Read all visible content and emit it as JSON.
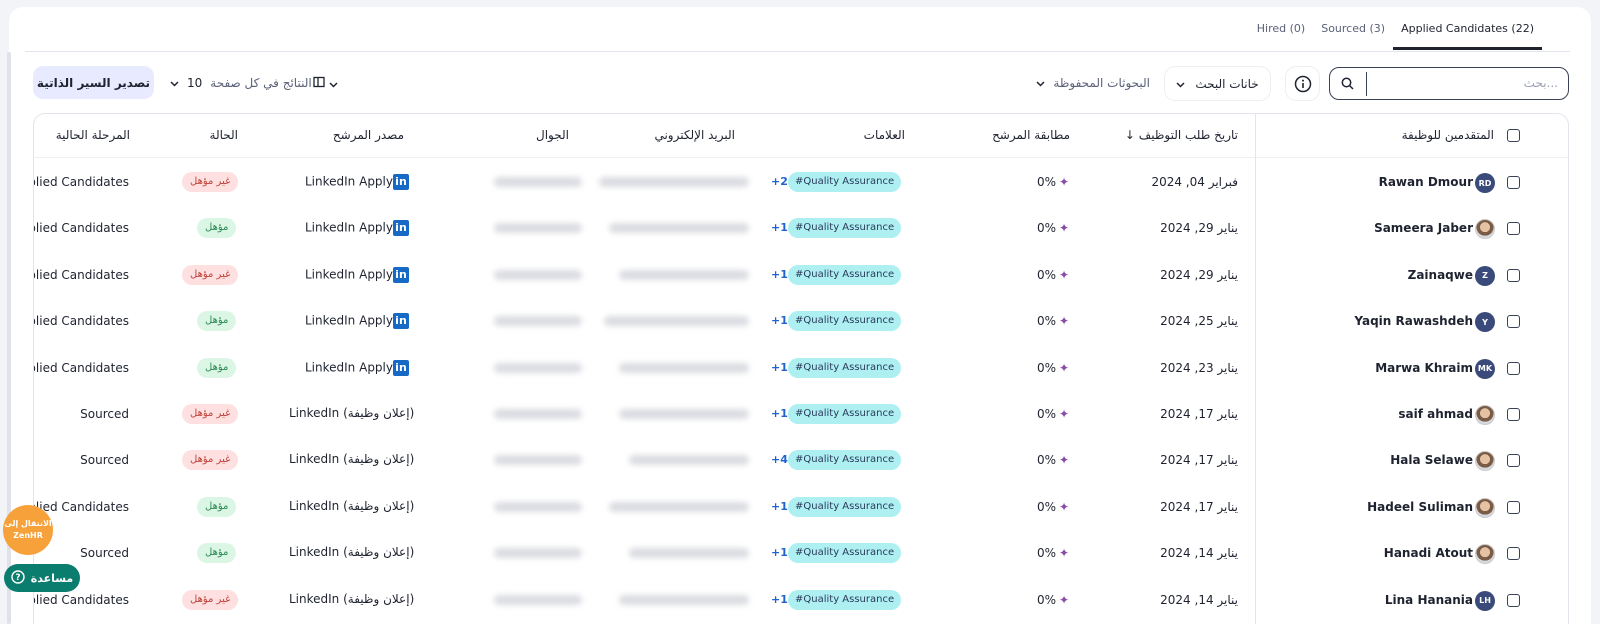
{
  "tabs": [
    {
      "label": "(22) Applied Candidates",
      "active": true
    },
    {
      "label": "(3) Sourced",
      "active": false
    },
    {
      "label": "(0) Hired",
      "active": false
    }
  ],
  "toolbar": {
    "search_placeholder": "بحث...",
    "search_fields_label": "خانات البحث",
    "saved_searches_label": "البحوثات المحفوظة",
    "per_page_label": "النتائج في كل صفحة",
    "per_page_value": "10",
    "export_label": "تصدير السير الذاتية"
  },
  "table": {
    "headers": {
      "applicants": "المتقدمين للوظيفة",
      "apply_date": "تاريخ طلب التوظيف",
      "match": "مطابقة المرشح",
      "tags": "العلامات",
      "email": "البريد الإلكتروني",
      "mobile": "الجوال",
      "source": "مصدر المرشح",
      "status": "الحالة",
      "stage": "المرحلة الحالية"
    },
    "rows": [
      {
        "name": "Rawan Dmour",
        "avatar": "RD",
        "date": "فبراير 04, 2024",
        "match": "0%",
        "tag": "#Quality Assurance",
        "more": "+2",
        "source": "LinkedIn Apply",
        "li": true,
        "status": "غير مؤهل",
        "status_type": "bad",
        "stage": "Applied Candidates"
      },
      {
        "name": "Sameera Jaber",
        "avatar": "",
        "date": "يناير 29, 2024",
        "match": "0%",
        "tag": "#Quality Assurance",
        "more": "+1",
        "source": "LinkedIn Apply",
        "li": true,
        "status": "مؤهل",
        "status_type": "good",
        "stage": "Applied Candidates"
      },
      {
        "name": "Zainaqwe",
        "avatar": "Z",
        "date": "يناير 29, 2024",
        "match": "0%",
        "tag": "#Quality Assurance",
        "more": "+1",
        "source": "LinkedIn Apply",
        "li": true,
        "status": "غير مؤهل",
        "status_type": "bad",
        "stage": "Applied Candidates"
      },
      {
        "name": "Yaqin Rawashdeh",
        "avatar": "Y",
        "date": "يناير 25, 2024",
        "match": "0%",
        "tag": "#Quality Assurance",
        "more": "+1",
        "source": "LinkedIn Apply",
        "li": true,
        "status": "مؤهل",
        "status_type": "good",
        "stage": "Applied Candidates"
      },
      {
        "name": "Marwa Khraim",
        "avatar": "MK",
        "date": "يناير 23, 2024",
        "match": "0%",
        "tag": "#Quality Assurance",
        "more": "+1",
        "source": "LinkedIn Apply",
        "li": true,
        "status": "مؤهل",
        "status_type": "good",
        "stage": "Applied Candidates"
      },
      {
        "name": "saif ahmad",
        "avatar": "",
        "date": "يناير 17, 2024",
        "match": "0%",
        "tag": "#Quality Assurance",
        "more": "+1",
        "source": "LinkedIn (إعلان وظيفة)",
        "li": false,
        "status": "غير مؤهل",
        "status_type": "bad",
        "stage": "Sourced"
      },
      {
        "name": "Hala Selawe",
        "avatar": "",
        "date": "يناير 17, 2024",
        "match": "0%",
        "tag": "#Quality Assurance",
        "more": "+4",
        "source": "LinkedIn (إعلان وظيفة)",
        "li": false,
        "status": "غير مؤهل",
        "status_type": "bad",
        "stage": "Sourced"
      },
      {
        "name": "Hadeel Suliman",
        "avatar": "",
        "date": "يناير 17, 2024",
        "match": "0%",
        "tag": "#Quality Assurance",
        "more": "+1",
        "source": "LinkedIn (إعلان وظيفة)",
        "li": false,
        "status": "مؤهل",
        "status_type": "good",
        "stage": "Applied Candidates"
      },
      {
        "name": "Hanadi Atout",
        "avatar": "",
        "date": "يناير 14, 2024",
        "match": "0%",
        "tag": "#Quality Assurance",
        "more": "+1",
        "source": "LinkedIn (إعلان وظيفة)",
        "li": false,
        "status": "مؤهل",
        "status_type": "good",
        "stage": "Sourced"
      },
      {
        "name": "Lina Hanania",
        "avatar": "LH",
        "date": "يناير 14, 2024",
        "match": "0%",
        "tag": "#Quality Assurance",
        "more": "+1",
        "source": "LinkedIn (إعلان وظيفة)",
        "li": false,
        "status": "غير مؤهل",
        "status_type": "bad",
        "stage": "Applied Candidates"
      }
    ]
  },
  "floating": {
    "zenhr_label": "الانتقال إلى ZenHR",
    "help_label": "مساعدة"
  },
  "colors": {
    "accent": "#1f2330",
    "tag_bg": "#aef0f2",
    "help": "#0b7d6f",
    "zenhr": "#f7a13a"
  }
}
